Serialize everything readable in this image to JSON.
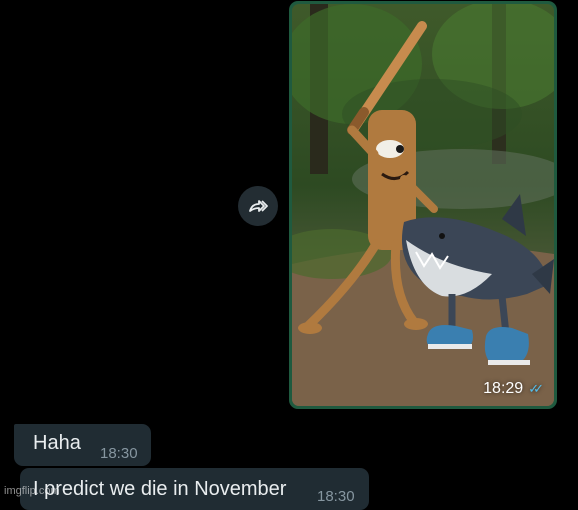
{
  "messages": [
    {
      "type": "image",
      "direction": "outgoing",
      "image_description": "gif",
      "time": "18:29",
      "status": "read",
      "status_icon": "double-check-icon",
      "bubble_color": "#1f5a3f"
    },
    {
      "type": "text",
      "direction": "incoming",
      "text": "Haha",
      "time": "18:30"
    },
    {
      "type": "text",
      "direction": "incoming",
      "text": "I predict we die in November",
      "time": "18:30"
    }
  ],
  "forward_button": {
    "icon": "forward-icon"
  },
  "watermark": "imgflip.com",
  "colors": {
    "background": "#000000",
    "incoming_bubble": "#202c33",
    "read_ticks": "#53bdeb",
    "timestamp": "#8696a0"
  }
}
